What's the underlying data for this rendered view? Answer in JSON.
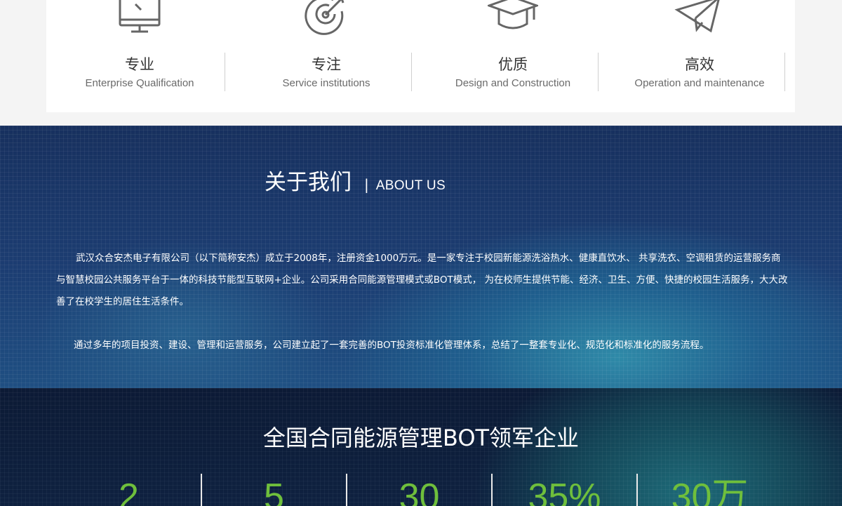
{
  "features": [
    {
      "icon": "monitor-icon",
      "title": "专业",
      "subtitle": "Enterprise Qualification"
    },
    {
      "icon": "target-icon",
      "title": "专注",
      "subtitle": "Service institutions"
    },
    {
      "icon": "graduation-cap-icon",
      "title": "优质",
      "subtitle": "Design and Construction"
    },
    {
      "icon": "paper-plane-icon",
      "title": "高效",
      "subtitle": "Operation and maintenance"
    }
  ],
  "about": {
    "title_cn": "关于我们",
    "separator": "|",
    "title_en": "ABOUT US",
    "paragraph1": "武汉众合安杰电子有限公司（以下简称安杰）成立于2008年，注册资金1000万元。是一家专注于校园新能源洗浴热水、健康直饮水、 共享洗衣、空调租赁的运营服务商与智慧校园公共服务平台于一体的科技节能型互联网+企业。公司采用合同能源管理模式或BOT模式， 为在校师生提供节能、经济、卫生、方便、快捷的校园生活服务，大大改善了在校学生的居住生活条件。",
    "paragraph2": "通过多年的项目投资、建设、管理和运营服务，公司建立起了一套完善的BOT投资标准化管理体系，总结了一整套专业化、规范化和标准化的服务流程。"
  },
  "stats": {
    "title": "全国合同能源管理BOT领军企业",
    "values": [
      "2",
      "5",
      "30",
      "35%",
      "30万"
    ]
  },
  "colors": {
    "accent_green": "#6fbf3c",
    "about_bg": "#1c3d72",
    "stats_bg": "#0c1a35"
  }
}
